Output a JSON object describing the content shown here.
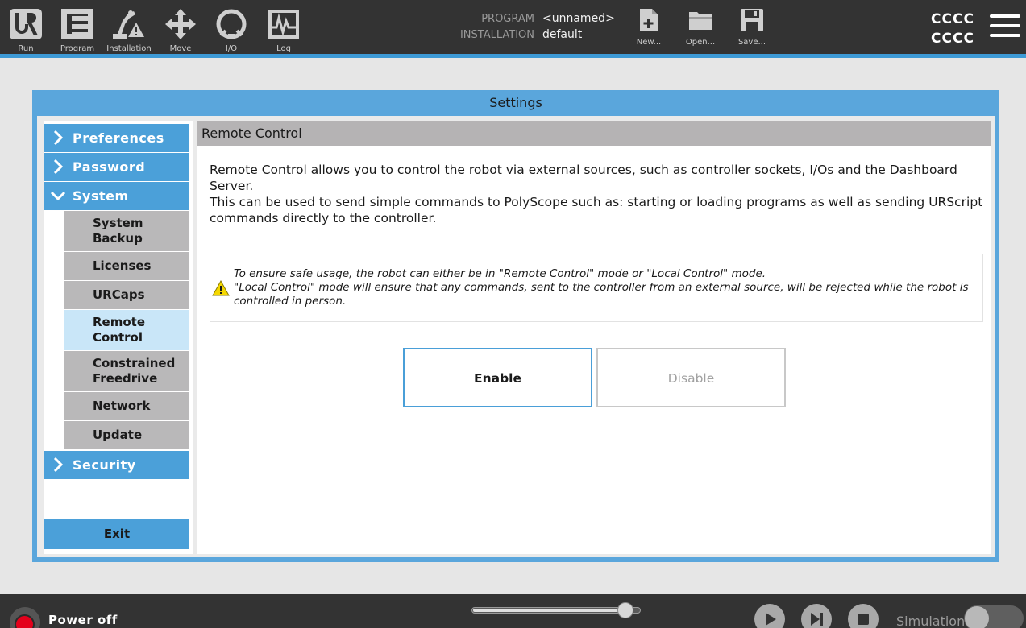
{
  "topbar": {
    "nav": [
      {
        "label": "Run",
        "icon": "ur-logo-icon"
      },
      {
        "label": "Program",
        "icon": "program-icon"
      },
      {
        "label": "Installation",
        "icon": "installation-robot-icon"
      },
      {
        "label": "Move",
        "icon": "move-arrows-icon"
      },
      {
        "label": "I/O",
        "icon": "io-icon"
      },
      {
        "label": "Log",
        "icon": "log-pulse-icon"
      }
    ],
    "program_label": "PROGRAM",
    "program_value": "<unnamed>",
    "installation_label": "INSTALLATION",
    "installation_value": "default",
    "file_actions": [
      {
        "label": "New...",
        "icon": "new-file-icon"
      },
      {
        "label": "Open...",
        "icon": "open-folder-icon"
      },
      {
        "label": "Save...",
        "icon": "save-disk-icon"
      }
    ],
    "status_line1": "CCCC",
    "status_line2": "CCCC",
    "accent_color": "#3d9ad6"
  },
  "dialog": {
    "title": "Settings"
  },
  "sidebar": {
    "categories": [
      {
        "label": "Preferences",
        "expanded": false
      },
      {
        "label": "Password",
        "expanded": false
      },
      {
        "label": "System",
        "expanded": true
      },
      {
        "label": "Security",
        "expanded": false
      }
    ],
    "system_items": [
      {
        "label": "System Backup"
      },
      {
        "label": "Licenses"
      },
      {
        "label": "URCaps"
      },
      {
        "label": "Remote Control",
        "active": true
      },
      {
        "label": "Constrained Freedrive"
      },
      {
        "label": "Network"
      },
      {
        "label": "Update"
      }
    ],
    "exit_label": "Exit"
  },
  "content": {
    "header": "Remote Control",
    "description_line1": "Remote Control allows you to control the robot via external sources, such as controller sockets, I/Os and the Dashboard Server.",
    "description_line2": "This can be used to send simple commands to PolyScope such as: starting or loading programs as well as sending URScript commands directly to the controller.",
    "warning_line1": "To ensure safe usage, the robot can either be in \"Remote Control\" mode or \"Local Control\" mode.",
    "warning_line2": "\"Local Control\" mode will ensure that any commands, sent to the controller from an external source, will be rejected while the robot is controlled in person.",
    "enable_label": "Enable",
    "disable_label": "Disable"
  },
  "footer": {
    "power_label": "Power off",
    "speed_fraction": 0.95,
    "simulation_label": "Simulation",
    "simulation_on": false
  }
}
